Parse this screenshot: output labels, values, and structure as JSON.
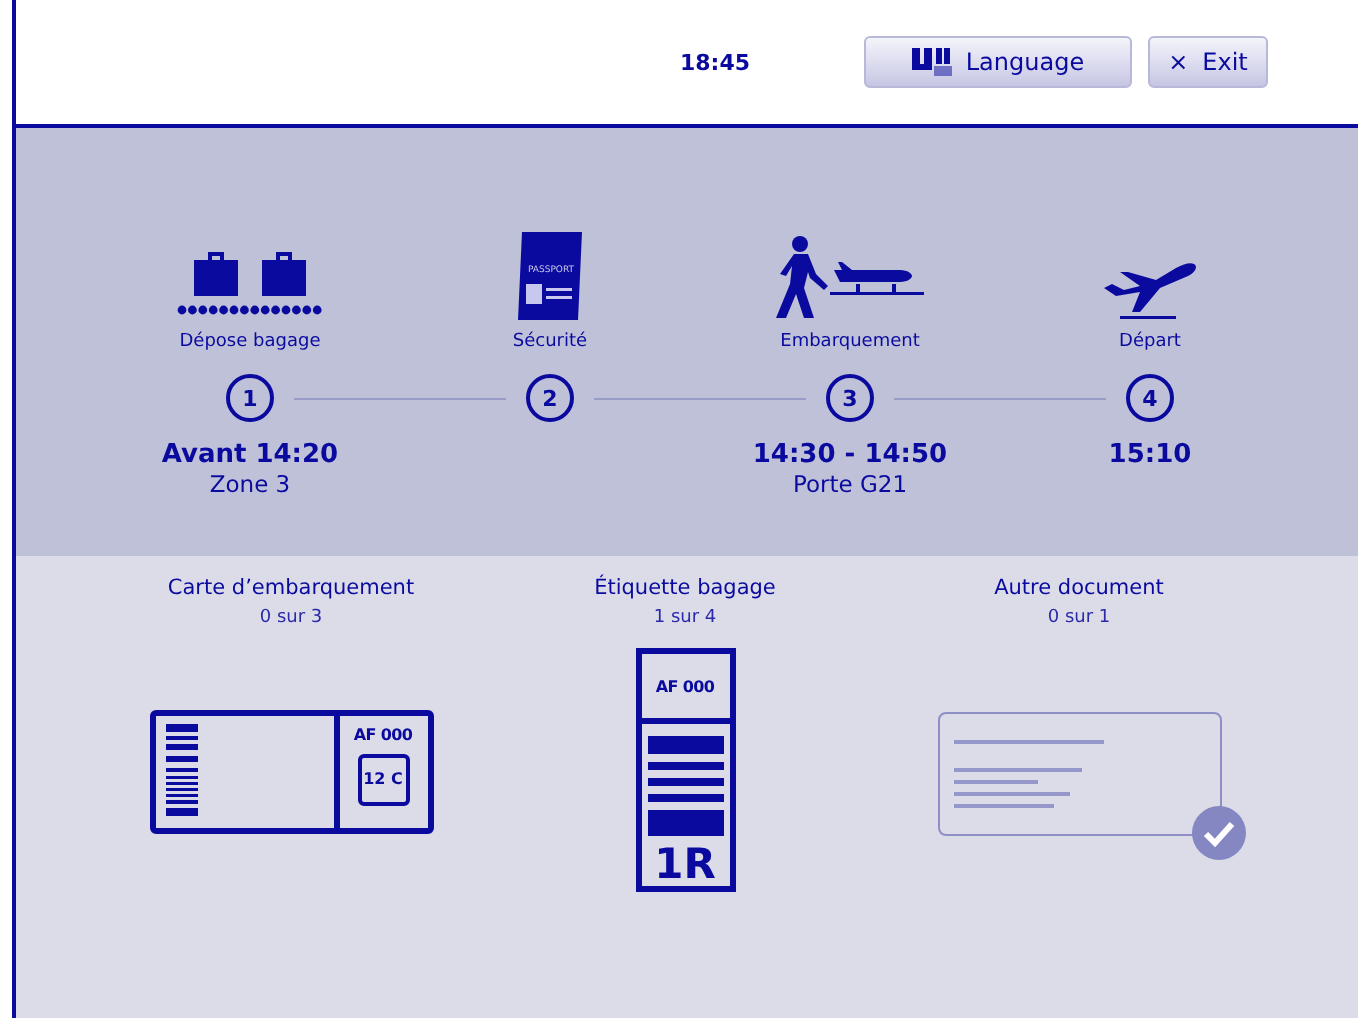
{
  "header": {
    "time": "18:45",
    "buttons": [
      {
        "kind": "language",
        "label": "Language"
      },
      {
        "kind": "exit",
        "label": "Exit",
        "icon": "×"
      }
    ]
  },
  "steps": [
    {
      "kind": "bags",
      "label": "Dépose bagage",
      "number": "1",
      "time": "Avant 14:20",
      "detail": "Zone 3"
    },
    {
      "kind": "passport",
      "label": "Sécurité",
      "number": "2",
      "passport_text": "PASSPORT"
    },
    {
      "kind": "boarding",
      "label": "Embarquement",
      "number": "3",
      "time": "14:30 - 14:50",
      "detail": "Porte G21"
    },
    {
      "kind": "departure",
      "label": "Départ",
      "number": "4",
      "time": "15:10"
    }
  ],
  "documents": [
    {
      "kind": "boarding-pass",
      "title": "Carte d’embarquement",
      "count": "0 sur 3",
      "checked": false,
      "flight": "AF 000",
      "seat": "12 C"
    },
    {
      "kind": "bag-tag",
      "title": "Étiquette bagage",
      "count": "1 sur 4",
      "checked": false,
      "flight": "AF 000",
      "code": "1R"
    },
    {
      "kind": "document",
      "title": "Autre document",
      "count": "0 sur 1",
      "checked": true
    }
  ]
}
